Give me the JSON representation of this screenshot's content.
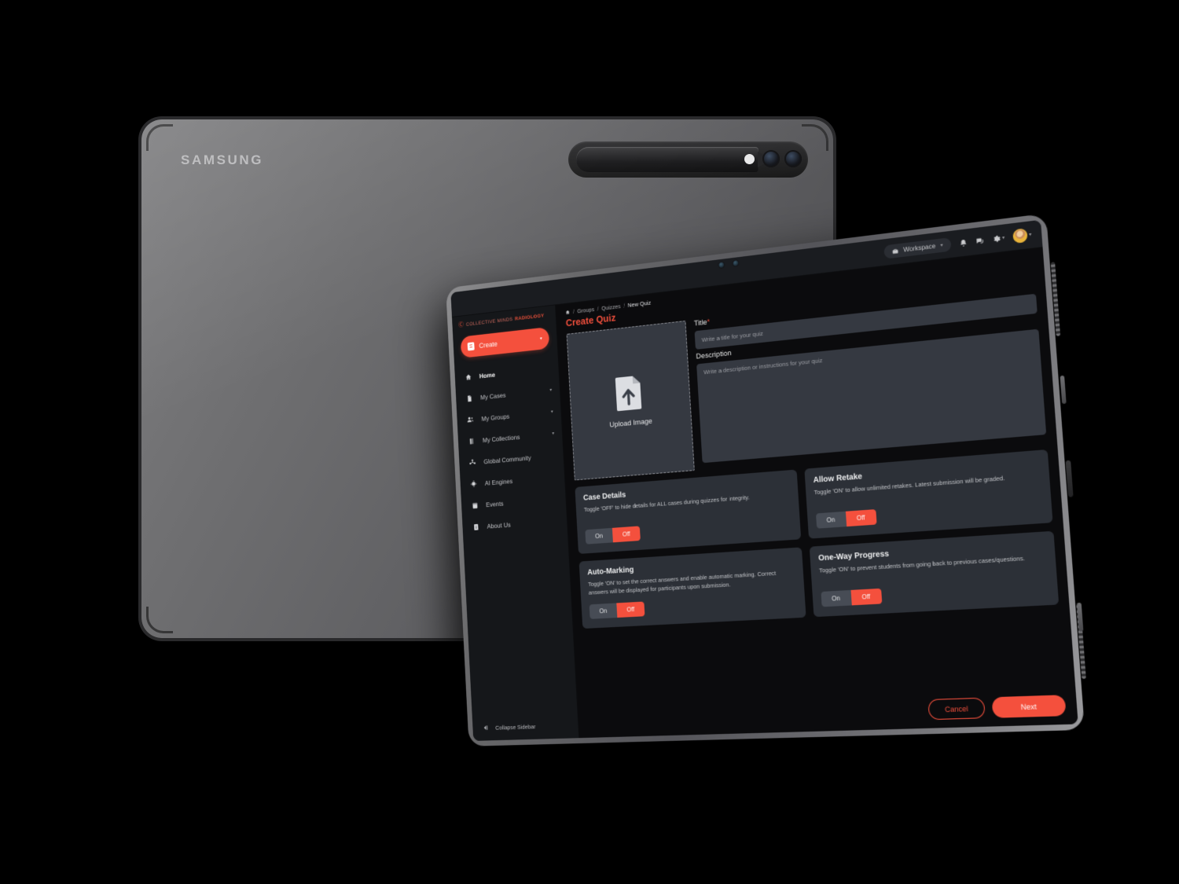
{
  "device": {
    "back_brand": "SAMSUNG",
    "back_icons": {
      "spen": "stylus-pen",
      "flash": "camera-flash",
      "lens_a": "camera-lens",
      "lens_b": "camera-lens"
    },
    "front_icons": {
      "cam_a": "front-camera",
      "cam_b": "front-camera"
    }
  },
  "header": {
    "workspace_label": "Workspace",
    "workspace_icon": "briefcase-icon",
    "workspace_caret": "▾",
    "bell_icon": "notifications-bell-icon",
    "chat_icon": "messages-chat-icon",
    "gear_icon": "settings-gear-icon",
    "gear_caret": "▾",
    "avatar_icon": "user-avatar",
    "avatar_caret": "▾"
  },
  "sidebar": {
    "brand_mark": "Ⓒ",
    "brand_part_a": "COLLECTIVE MINDS",
    "brand_part_b": "RADIOLOGY",
    "create_label": "Create",
    "create_caret": "▾",
    "items": [
      {
        "label": "Home",
        "icon": "home-icon",
        "chevron": "",
        "active": true
      },
      {
        "label": "My Cases",
        "icon": "cases-folder-icon",
        "chevron": "▾",
        "active": false
      },
      {
        "label": "My Groups",
        "icon": "groups-people-icon",
        "chevron": "▾",
        "active": false
      },
      {
        "label": "My Collections",
        "icon": "collections-book-icon",
        "chevron": "▾",
        "active": false
      },
      {
        "label": "Global Community",
        "icon": "global-community-icon",
        "chevron": "",
        "active": false
      },
      {
        "label": "AI Engines",
        "icon": "ai-engines-chip-icon",
        "chevron": "",
        "active": false
      },
      {
        "label": "Events",
        "icon": "events-calendar-icon",
        "chevron": "",
        "active": false
      },
      {
        "label": "About Us",
        "icon": "about-info-icon",
        "chevron": "",
        "active": false
      }
    ],
    "collapse_label": "Collapse Sidebar",
    "collapse_icon": "collapse-sidebar-icon"
  },
  "breadcrumb": {
    "home_icon": "home-icon",
    "sep": "/",
    "items": [
      "Groups",
      "Quizzes",
      "New Quiz"
    ]
  },
  "page": {
    "title": "Create Quiz"
  },
  "form": {
    "upload": {
      "label": "Upload Image",
      "icon": "file-upload-icon"
    },
    "title_field": {
      "label": "Title",
      "required_mark": "*",
      "value": "",
      "placeholder": "Write a title for your quiz"
    },
    "description_field": {
      "label": "Description",
      "value": "",
      "placeholder": "Write a description or instructions for your quiz"
    }
  },
  "settings_cards": [
    {
      "title": "Case Details",
      "description": "Toggle 'OFF' to hide details for ALL cases during quizzes for integrity.",
      "on_label": "On",
      "off_label": "Off",
      "selected": "Off"
    },
    {
      "title": "Allow Retake",
      "description": "Toggle 'ON' to allow unlimited retakes. Latest submission will be graded.",
      "on_label": "On",
      "off_label": "Off",
      "selected": "Off"
    },
    {
      "title": "Auto-Marking",
      "description": "Toggle 'ON' to set the correct answers and enable automatic marking. Correct answers will be displayed for participants upon submission.",
      "on_label": "On",
      "off_label": "Off",
      "selected": "Off"
    },
    {
      "title": "One-Way Progress",
      "description": "Toggle 'ON' to prevent students from going back to previous cases/questions.",
      "on_label": "On",
      "off_label": "Off",
      "selected": "Off"
    }
  ],
  "footer": {
    "cancel_label": "Cancel",
    "next_label": "Next"
  },
  "colors": {
    "accent": "#f4503d",
    "page_bg": "#0b0b0d",
    "sidebar_bg": "#15171a",
    "card_bg": "#2c3037",
    "input_bg": "#353941",
    "topbar_bg": "#1a1c20"
  }
}
